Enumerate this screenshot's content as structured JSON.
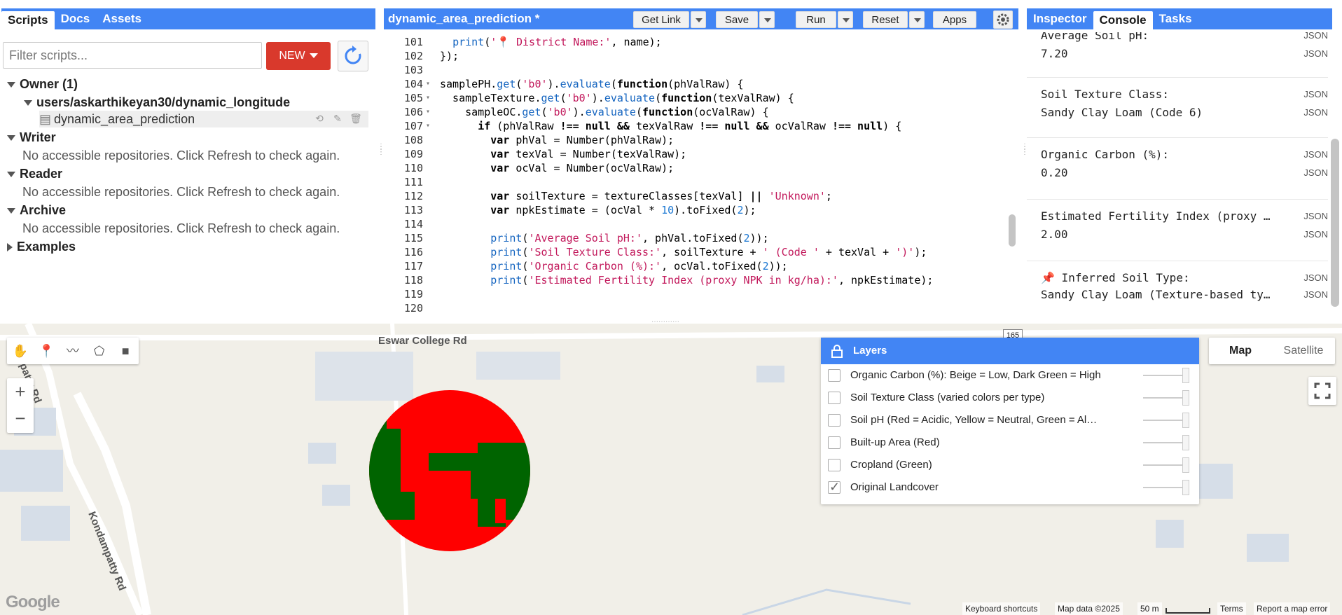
{
  "left_panel": {
    "tabs": [
      "Scripts",
      "Docs",
      "Assets"
    ],
    "active_tab": "Scripts",
    "filter_placeholder": "Filter scripts...",
    "new_button": "NEW",
    "tree": {
      "owner": "Owner (1)",
      "repo": "users/askarthikeyan30/dynamic_longitude",
      "file": "dynamic_area_prediction",
      "writer": "Writer",
      "writer_msg": "No accessible repositories. Click Refresh to check again.",
      "reader": "Reader",
      "reader_msg": "No accessible repositories. Click Refresh to check again.",
      "archive": "Archive",
      "archive_msg": "No accessible repositories. Click Refresh to check again.",
      "examples": "Examples"
    }
  },
  "editor": {
    "title": "dynamic_area_prediction *",
    "buttons": {
      "get_link": "Get Link",
      "save": "Save",
      "run": "Run",
      "reset": "Reset",
      "apps": "Apps"
    },
    "line_numbers": [
      "101",
      "102",
      "103",
      "104",
      "105",
      "106",
      "107",
      "108",
      "109",
      "110",
      "111",
      "112",
      "113",
      "114",
      "115",
      "116",
      "117",
      "118",
      "119",
      "120"
    ]
  },
  "console": {
    "tabs": [
      "Inspector",
      "Console",
      "Tasks"
    ],
    "active_tab": "Console",
    "json_label": "JSON",
    "entries": [
      {
        "label": "Average Soil pH:",
        "value": "7.20"
      },
      {
        "label": "Soil Texture Class:",
        "value": "Sandy Clay Loam (Code 6)"
      },
      {
        "label": "Organic Carbon (%):",
        "value": "0.20"
      },
      {
        "label": "Estimated Fertility Index (proxy …",
        "value": "2.00"
      },
      {
        "label": "📌 Inferred Soil Type:",
        "value": "Sandy Clay Loam (Texture-based ty…"
      }
    ]
  },
  "map": {
    "roads": {
      "eswar": "Eswar College Rd",
      "kondampatty": "Kondampatty Rd",
      "pattyrd": "patty Rd",
      "shield": "165"
    },
    "map_type": {
      "map": "Map",
      "satellite": "Satellite"
    },
    "layers": {
      "title": "Layers",
      "items": [
        {
          "name": "Organic Carbon (%): Beige = Low, Dark Green = High",
          "checked": false
        },
        {
          "name": "Soil Texture Class (varied colors per type)",
          "checked": false
        },
        {
          "name": "Soil pH (Red = Acidic, Yellow = Neutral, Green = Al…",
          "checked": false
        },
        {
          "name": "Built-up Area (Red)",
          "checked": false
        },
        {
          "name": "Cropland (Green)",
          "checked": false
        },
        {
          "name": "Original Landcover",
          "checked": true
        }
      ]
    },
    "attribution": {
      "shortcuts": "Keyboard shortcuts",
      "data": "Map data ©2025",
      "scale": "50 m",
      "terms": "Terms",
      "report": "Report a map error"
    },
    "logo": "Google",
    "colors": {
      "builtup": "#ff0000",
      "cropland": "#006400"
    }
  }
}
